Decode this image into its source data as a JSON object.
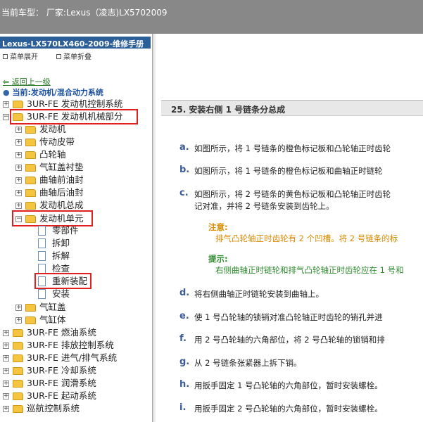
{
  "topbar": {
    "title": "当前车型：  厂家:Lexus（凌志)LX5702009"
  },
  "sidebar": {
    "manual_title": "Lexus-LX570LX460-2009-维修手册",
    "expand_all": "菜单展开",
    "collapse_all": "菜单折叠",
    "back": "返回上一级",
    "current": "当前:发动机/混合动力系统",
    "tree": [
      {
        "label": "3UR-FE 发动机控制系统"
      },
      {
        "label": "3UR-FE 发动机机械部分"
      },
      {
        "label": "发动机"
      },
      {
        "label": "传动皮带"
      },
      {
        "label": "凸轮轴"
      },
      {
        "label": "气缸盖衬垫"
      },
      {
        "label": "曲轴前油封"
      },
      {
        "label": "曲轴后油封"
      },
      {
        "label": "发动机总成"
      },
      {
        "label": "发动机单元"
      },
      {
        "label": "零部件"
      },
      {
        "label": "拆卸"
      },
      {
        "label": "拆解"
      },
      {
        "label": "检查"
      },
      {
        "label": "重新装配"
      },
      {
        "label": "安装"
      },
      {
        "label": "气缸盖"
      },
      {
        "label": "气缸体"
      },
      {
        "label": "3UR-FE 燃油系统"
      },
      {
        "label": "3UR-FE 排放控制系统"
      },
      {
        "label": "3UR-FE 进气/排气系统"
      },
      {
        "label": "3UR-FE 冷却系统"
      },
      {
        "label": "3UR-FE 润滑系统"
      },
      {
        "label": "3UR-FE 起动系统"
      },
      {
        "label": "巡航控制系统"
      }
    ]
  },
  "content": {
    "section_title": "25. 安装右侧 1 号链条分总成",
    "steps": [
      {
        "letter": "a.",
        "text": "如图所示，将 1 号链条的橙色标记板和凸轮轴正时齿轮"
      },
      {
        "letter": "b.",
        "text": "如图所示，将 1 号链条的橙色标记板和曲轴正时链轮"
      },
      {
        "letter": "c.",
        "text": "如图所示，将 2 号链条的黄色标记板和凸轮轴正时齿轮"
      },
      {
        "letter": "",
        "text": "记对准，并将 2 号链条安装到齿轮上。"
      },
      {
        "letter": "d.",
        "text": "将右侧曲轴正时链轮安装到曲轴上。"
      },
      {
        "letter": "e.",
        "text": "使 1 号凸轮轴的锁销对准凸轮轴正时齿轮的销孔并进"
      },
      {
        "letter": "f.",
        "text": "用 2 号凸轮轴的六角部位，将 2 号凸轮轴的锁销和排"
      },
      {
        "letter": "g.",
        "text": "从 2 号链条张紧器上拆下销。"
      },
      {
        "letter": "h.",
        "text": "用扳手固定 1 号凸轮轴的六角部位，暂时安装螺栓。"
      },
      {
        "letter": "i.",
        "text": "用扳手固定 2 号凸轮轴的六角部位，暂时安装螺栓。"
      }
    ],
    "caution_label": "注意:",
    "caution_text": "排气凸轮轴正时齿轮有 2 个凹槽。将 2 号链条的标",
    "hint_label": "提示:",
    "hint_text": "右侧曲轴正时链轮和排气凸轮轴正时齿轮应在 1 号和"
  },
  "colors": {
    "caution": "#d98a00",
    "hint": "#2c8a2c",
    "highlight": "#e02020"
  }
}
